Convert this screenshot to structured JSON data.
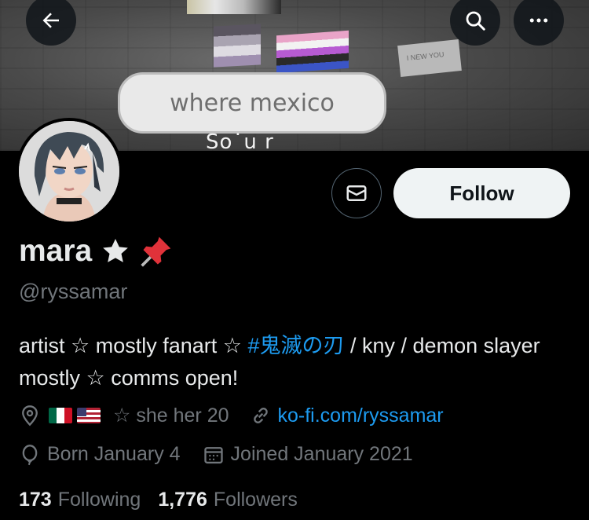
{
  "banner": {
    "bubble_text": "where mexico",
    "sub_text": "So˙u r",
    "sign_text": "I NEW YOU"
  },
  "profile": {
    "name": "mara",
    "handle": "@ryssamar",
    "bio": {
      "part1": "artist ☆ mostly fanart ☆ ",
      "hashtag": "#鬼滅の刃",
      "part2": " / kny / demon slayer mostly ☆ comms open!"
    },
    "location_flags": [
      "mexico-flag",
      "usa-flag"
    ],
    "pronouns_text": "☆ she her 20",
    "website": "ko-fi.com/ryssamar",
    "birthday": "Born January 4",
    "joined": "Joined January 2021",
    "following_count": "173",
    "following_label": "Following",
    "followers_count": "1,776",
    "followers_label": "Followers"
  },
  "actions": {
    "follow_label": "Follow"
  },
  "icons": {
    "back": "arrow-left-icon",
    "search": "search-icon",
    "more": "more-horizontal-icon",
    "message": "envelope-icon",
    "location": "location-pin-icon",
    "link": "link-icon",
    "birthday": "balloon-icon",
    "calendar": "calendar-icon",
    "star": "star-icon",
    "pin": "pushpin-icon"
  },
  "colors": {
    "background": "#000000",
    "text_primary": "#e7e9ea",
    "text_secondary": "#71767b",
    "link": "#1d9bf0",
    "follow_bg": "#eff3f4"
  }
}
